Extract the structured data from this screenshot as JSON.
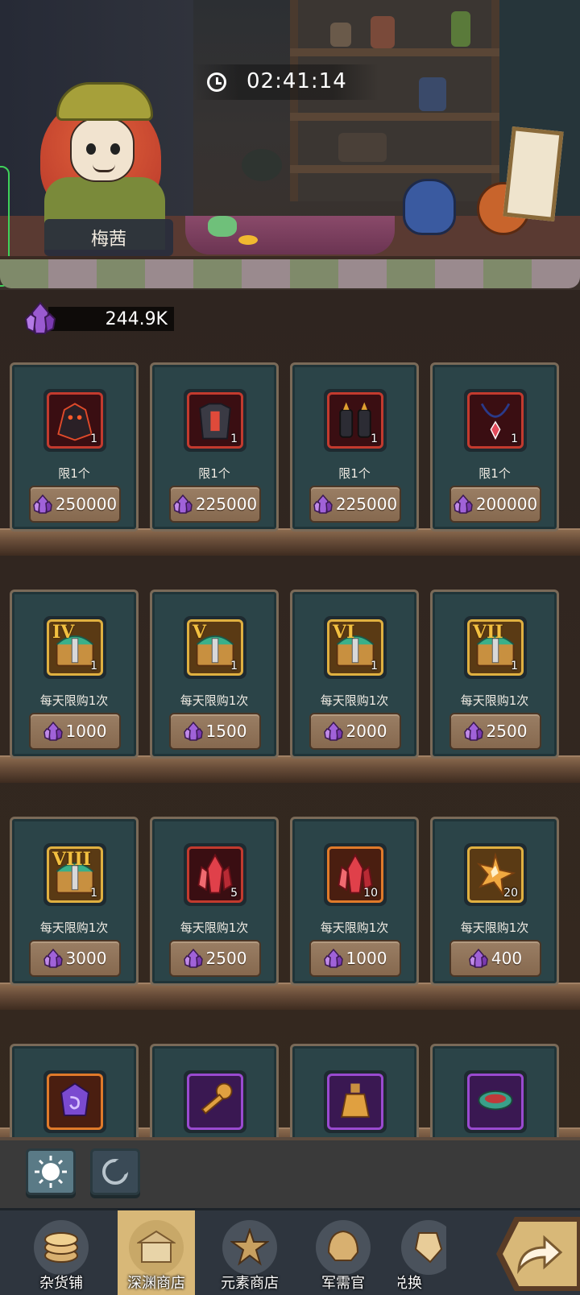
{
  "shop": {
    "keeper_name": "梅茜",
    "timer": "02:41:14",
    "currency": "244.9K"
  },
  "rows": [
    {
      "items": [
        {
          "icon": "dragon-armor-icon",
          "qty": "1",
          "limit": "限1个",
          "price": "250000",
          "frame": "red"
        },
        {
          "icon": "dark-armor-icon",
          "qty": "1",
          "limit": "限1个",
          "price": "225000",
          "frame": "red"
        },
        {
          "icon": "dark-gauntlets-icon",
          "qty": "1",
          "limit": "限1个",
          "price": "225000",
          "frame": "red"
        },
        {
          "icon": "amulet-icon",
          "qty": "1",
          "limit": "限1个",
          "price": "200000",
          "frame": "red"
        }
      ]
    },
    {
      "items": [
        {
          "icon": "treasure-chest-icon",
          "roman": "IV",
          "qty": "1",
          "limit": "每天限购1次",
          "price": "1000",
          "frame": "gold"
        },
        {
          "icon": "treasure-chest-icon",
          "roman": "V",
          "qty": "1",
          "limit": "每天限购1次",
          "price": "1500",
          "frame": "gold"
        },
        {
          "icon": "treasure-chest-icon",
          "roman": "VI",
          "qty": "1",
          "limit": "每天限购1次",
          "price": "2000",
          "frame": "gold"
        },
        {
          "icon": "treasure-chest-icon",
          "roman": "VII",
          "qty": "1",
          "limit": "每天限购1次",
          "price": "2500",
          "frame": "gold"
        }
      ]
    },
    {
      "items": [
        {
          "icon": "treasure-chest-icon",
          "roman": "VIII",
          "qty": "1",
          "limit": "每天限购1次",
          "price": "3000",
          "frame": "gold"
        },
        {
          "icon": "red-crystal-icon",
          "qty": "5",
          "limit": "每天限购1次",
          "price": "2500",
          "frame": "red"
        },
        {
          "icon": "red-crystal-icon",
          "qty": "10",
          "limit": "每天限购1次",
          "price": "1000",
          "frame": "orange"
        },
        {
          "icon": "gold-crystal-icon",
          "qty": "20",
          "limit": "每天限购1次",
          "price": "400",
          "frame": "gold"
        }
      ]
    },
    {
      "items": [
        {
          "icon": "rune-stone-icon",
          "frame": "orange"
        },
        {
          "icon": "key-icon",
          "frame": "purple"
        },
        {
          "icon": "potion-icon",
          "frame": "purple"
        },
        {
          "icon": "bowl-icon",
          "frame": "purple"
        }
      ]
    }
  ],
  "modes": [
    {
      "icon": "sun-icon",
      "active": true
    },
    {
      "icon": "moon-icon",
      "active": false
    }
  ],
  "nav": [
    {
      "label": "杂货铺",
      "icon": "coins-icon",
      "active": false
    },
    {
      "label": "深渊商店",
      "icon": "abyss-shop-icon",
      "active": true
    },
    {
      "label": "元素商店",
      "icon": "element-star-icon",
      "active": false
    },
    {
      "label": "军需官",
      "icon": "helmet-icon",
      "active": false
    },
    {
      "label": "兑换",
      "icon": "exchange-icon",
      "active": false
    }
  ],
  "colors": {
    "card_bg": "#2b4448",
    "price_button": "#8e7258",
    "nav_active": "#d8b878",
    "crystal": "#9a5ad0"
  }
}
